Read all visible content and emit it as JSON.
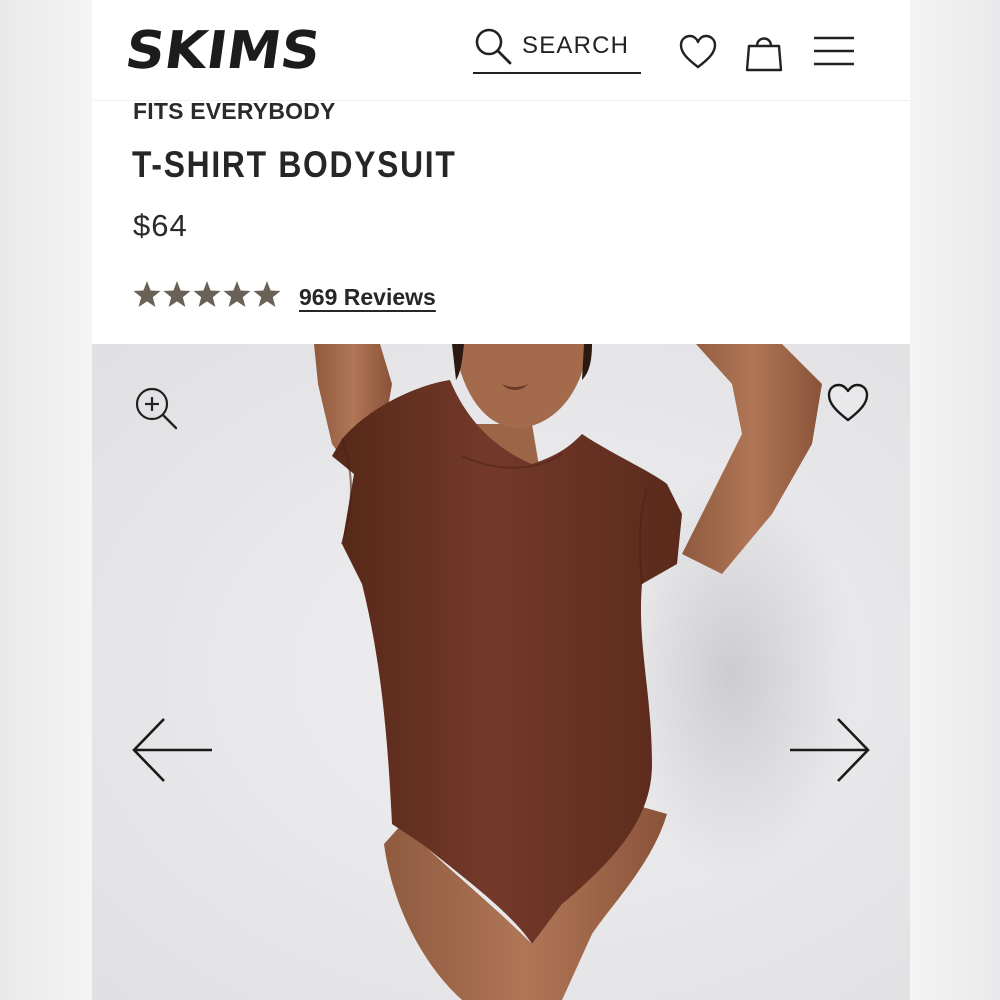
{
  "brand": {
    "logo_text": "SKIMS"
  },
  "header": {
    "search_label": "SEARCH",
    "icons": [
      "search-icon",
      "heart-icon",
      "shopping-bag-icon",
      "menu-icon"
    ]
  },
  "product": {
    "collection": "FITS EVERYBODY",
    "title": "T-SHIRT BODYSUIT",
    "price": "$64",
    "rating": 5,
    "rating_max": 5,
    "reviews_label": "969 Reviews"
  },
  "gallery": {
    "icons": [
      "zoom-in-icon",
      "heart-icon",
      "arrow-left-icon",
      "arrow-right-icon"
    ]
  },
  "colors": {
    "star": "#6a6257",
    "text": "#262626",
    "bodysuit": "#6b3322",
    "skin": "#a26b4f",
    "gallery_bg": "#e6e6e9"
  }
}
